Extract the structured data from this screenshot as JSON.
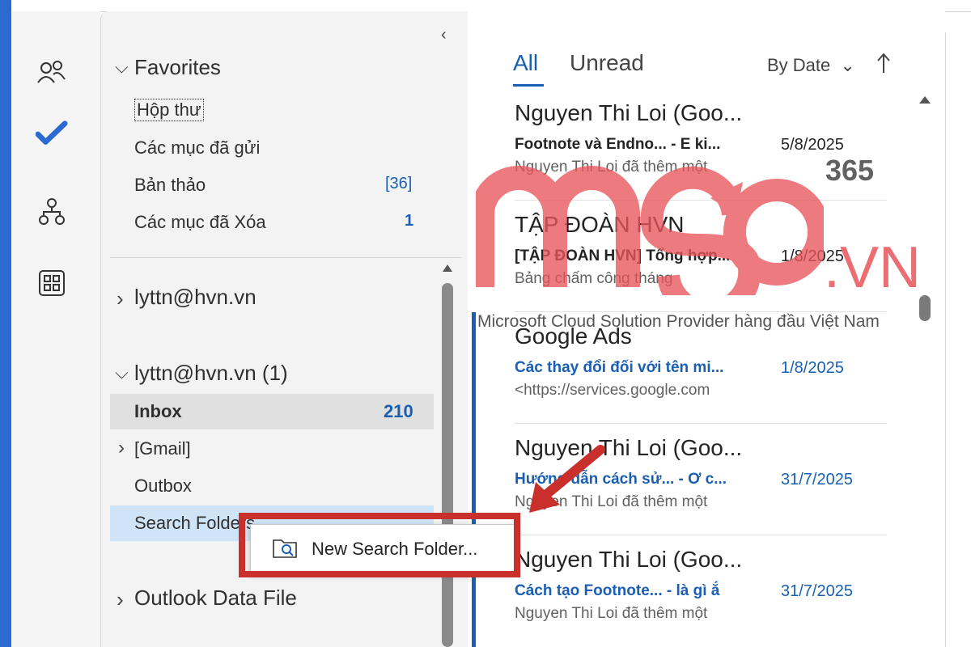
{
  "app_bar": {
    "items": [
      {
        "icon": "people-icon"
      },
      {
        "icon": "todo-check-icon"
      },
      {
        "icon": "org-chart-icon"
      },
      {
        "icon": "apps-grid-icon"
      }
    ]
  },
  "folder_pane": {
    "favorites": {
      "label": "Favorites",
      "items": [
        {
          "label": "Hộp thư",
          "count": ""
        },
        {
          "label": "Các mục đã gửi",
          "count": ""
        },
        {
          "label": "Bản thảo",
          "count": "[36]"
        },
        {
          "label": "Các mục đã Xóa",
          "count": "1"
        }
      ]
    },
    "account1": {
      "label": "lyttn@hvn.vn"
    },
    "account2": {
      "label": "lyttn@hvn.vn (1)",
      "items": [
        {
          "label": "Inbox",
          "count": "210"
        },
        {
          "label": "[Gmail]",
          "count": ""
        },
        {
          "label": "Outbox",
          "count": ""
        },
        {
          "label": "Search Folders",
          "count": ""
        }
      ]
    },
    "data_file": {
      "label": "Outlook Data File"
    }
  },
  "context_menu": {
    "item": "New Search Folder..."
  },
  "message_list": {
    "tabs": [
      "All",
      "Unread"
    ],
    "sort_label": "By Date",
    "messages": [
      {
        "sender": "Nguyen Thi Loi (Goo...",
        "subject": "Footnote và Endno... - E ki...",
        "date": "5/8/2025",
        "preview": "Nguyen Thi Loi đã thêm một",
        "unread": false
      },
      {
        "sender": "TẬP ĐOÀN HVN",
        "subject": "[TẬP ĐOÀN HVN] Tổng hợp...",
        "date": "1/8/2025",
        "preview": "Bảng chấm công tháng",
        "unread": false
      },
      {
        "sender": "Google Ads",
        "subject": "Các thay đổi đối với tên mi...",
        "date": "1/8/2025",
        "preview": "<https://services.google.com",
        "unread": true
      },
      {
        "sender": "Nguyen Thi Loi (Goo...",
        "subject": "Hướng dẫn cách sử... - Ơ c...",
        "date": "31/7/2025",
        "preview": "Nguyen Thi Loi đã thêm một",
        "unread": true
      },
      {
        "sender": "Nguyen Thi Loi (Goo...",
        "subject": "Cách tạo Footnote... - là gì ắ",
        "date": "31/7/2025",
        "preview": "Nguyen Thi Loi đã thêm một",
        "unread": true
      }
    ]
  },
  "watermark": {
    "brand": "MSO",
    "suffix": ".VN",
    "badge": "365",
    "tagline": "Microsoft Cloud Solution Provider hàng đầu Việt Nam",
    "color": "#e8555a"
  },
  "colors": {
    "accent": "#1a5fb4",
    "highlight_red": "#c9302c",
    "selected_folder": "#cfe4f7"
  }
}
